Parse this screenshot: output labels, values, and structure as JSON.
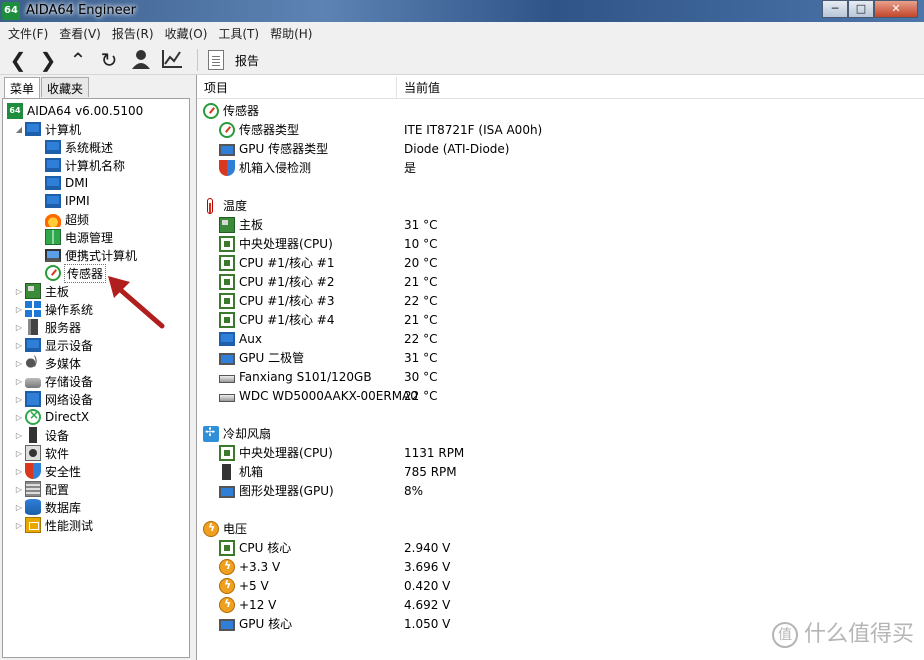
{
  "window": {
    "app_icon": "64",
    "title": "AIDA64 Engineer",
    "controls": [
      "─",
      "□",
      "✕"
    ]
  },
  "menu": [
    "文件(F)",
    "查看(V)",
    "报告(R)",
    "收藏(O)",
    "工具(T)",
    "帮助(H)"
  ],
  "toolbar": {
    "buttons": [
      "back-icon",
      "forward-icon",
      "up-icon",
      "refresh-icon",
      "user-icon",
      "chart-icon"
    ],
    "report_label": "报告"
  },
  "left": {
    "tabs": [
      "菜单",
      "收藏夹"
    ],
    "tree": [
      {
        "label": "AIDA64 v6.00.5100",
        "icon": "aida-icon",
        "level": 0,
        "arrow": ""
      },
      {
        "label": "计算机",
        "icon": "computer-icon",
        "level": 1,
        "arrow": "◢"
      },
      {
        "label": "系统概述",
        "icon": "monitor-icon",
        "level": 2,
        "arrow": ""
      },
      {
        "label": "计算机名称",
        "icon": "monitor-icon",
        "level": 2,
        "arrow": ""
      },
      {
        "label": "DMI",
        "icon": "monitor-icon",
        "level": 2,
        "arrow": ""
      },
      {
        "label": "IPMI",
        "icon": "monitor-icon",
        "level": 2,
        "arrow": ""
      },
      {
        "label": "超频",
        "icon": "fire-icon",
        "level": 2,
        "arrow": ""
      },
      {
        "label": "电源管理",
        "icon": "battery-icon",
        "level": 2,
        "arrow": ""
      },
      {
        "label": "便携式计算机",
        "icon": "laptop-icon",
        "level": 2,
        "arrow": ""
      },
      {
        "label": "传感器",
        "icon": "gauge-icon",
        "level": 2,
        "arrow": "",
        "selected": true
      },
      {
        "label": "主板",
        "icon": "board-icon",
        "level": 1,
        "arrow": "▷"
      },
      {
        "label": "操作系统",
        "icon": "windows-icon",
        "level": 1,
        "arrow": "▷"
      },
      {
        "label": "服务器",
        "icon": "server-icon",
        "level": 1,
        "arrow": "▷"
      },
      {
        "label": "显示设备",
        "icon": "display-icon",
        "level": 1,
        "arrow": "▷"
      },
      {
        "label": "多媒体",
        "icon": "speaker-icon",
        "level": 1,
        "arrow": "▷"
      },
      {
        "label": "存储设备",
        "icon": "drive-icon",
        "level": 1,
        "arrow": "▷"
      },
      {
        "label": "网络设备",
        "icon": "network-icon",
        "level": 1,
        "arrow": "▷"
      },
      {
        "label": "DirectX",
        "icon": "xbox-icon",
        "level": 1,
        "arrow": "▷"
      },
      {
        "label": "设备",
        "icon": "device-icon",
        "level": 1,
        "arrow": "▷"
      },
      {
        "label": "软件",
        "icon": "software-icon",
        "level": 1,
        "arrow": "▷"
      },
      {
        "label": "安全性",
        "icon": "shield-icon",
        "level": 1,
        "arrow": "▷"
      },
      {
        "label": "配置",
        "icon": "config-icon",
        "level": 1,
        "arrow": "▷"
      },
      {
        "label": "数据库",
        "icon": "database-icon",
        "level": 1,
        "arrow": "▷"
      },
      {
        "label": "性能测试",
        "icon": "benchmark-icon",
        "level": 1,
        "arrow": "▷"
      }
    ]
  },
  "right": {
    "columns": [
      "项目",
      "当前值"
    ],
    "rows": [
      {
        "type": "section",
        "name": "传感器",
        "icon": "gauge-icon",
        "value": ""
      },
      {
        "type": "item",
        "name": "传感器类型",
        "icon": "gauge-icon",
        "value": "ITE IT8721F  (ISA A00h)"
      },
      {
        "type": "item",
        "name": "GPU 传感器类型",
        "icon": "gpu-icon",
        "value": "Diode  (ATI-Diode)"
      },
      {
        "type": "item",
        "name": "机箱入侵检测",
        "icon": "shield-icon",
        "value": "是"
      },
      {
        "type": "blank"
      },
      {
        "type": "section",
        "name": "温度",
        "icon": "thermometer-icon",
        "value": ""
      },
      {
        "type": "item",
        "name": "主板",
        "icon": "board-icon",
        "value": "31 °C"
      },
      {
        "type": "item",
        "name": "中央处理器(CPU)",
        "icon": "cpu-icon",
        "value": "10 °C"
      },
      {
        "type": "item",
        "name": "CPU #1/核心 #1",
        "icon": "cpu-icon",
        "value": "20 °C"
      },
      {
        "type": "item",
        "name": "CPU #1/核心 #2",
        "icon": "cpu-icon",
        "value": "21 °C"
      },
      {
        "type": "item",
        "name": "CPU #1/核心 #3",
        "icon": "cpu-icon",
        "value": "22 °C"
      },
      {
        "type": "item",
        "name": "CPU #1/核心 #4",
        "icon": "cpu-icon",
        "value": "21 °C"
      },
      {
        "type": "item",
        "name": "Aux",
        "icon": "monitor-icon",
        "value": "22 °C"
      },
      {
        "type": "item",
        "name": "GPU 二极管",
        "icon": "gpu-icon",
        "value": "31 °C"
      },
      {
        "type": "item",
        "name": "Fanxiang S101/120GB",
        "icon": "hdd-icon",
        "value": "30 °C"
      },
      {
        "type": "item",
        "name": "WDC WD5000AAKX-00ERMA0",
        "icon": "hdd-icon",
        "value": "22 °C"
      },
      {
        "type": "blank"
      },
      {
        "type": "section",
        "name": "冷却风扇",
        "icon": "fan-icon",
        "value": ""
      },
      {
        "type": "item",
        "name": "中央处理器(CPU)",
        "icon": "cpu-icon",
        "value": "1131 RPM"
      },
      {
        "type": "item",
        "name": "机箱",
        "icon": "case-icon",
        "value": "785 RPM"
      },
      {
        "type": "item",
        "name": "图形处理器(GPU)",
        "icon": "gpu-icon",
        "value": "8%"
      },
      {
        "type": "blank"
      },
      {
        "type": "section",
        "name": "电压",
        "icon": "voltage-icon",
        "value": ""
      },
      {
        "type": "item",
        "name": "CPU 核心",
        "icon": "cpu-icon",
        "value": "2.940 V"
      },
      {
        "type": "item",
        "name": "+3.3 V",
        "icon": "voltage-icon",
        "value": "3.696 V"
      },
      {
        "type": "item",
        "name": "+5 V",
        "icon": "voltage-icon",
        "value": "0.420 V"
      },
      {
        "type": "item",
        "name": "+12 V",
        "icon": "voltage-icon",
        "value": "4.692 V"
      },
      {
        "type": "item",
        "name": "GPU 核心",
        "icon": "gpu-icon",
        "value": "1.050 V"
      }
    ]
  },
  "watermark": {
    "symbol": "值",
    "text": "什么值得买"
  },
  "colors": {
    "annotation_arrow": "#b01e1e",
    "accent": "#1e8e3e"
  }
}
